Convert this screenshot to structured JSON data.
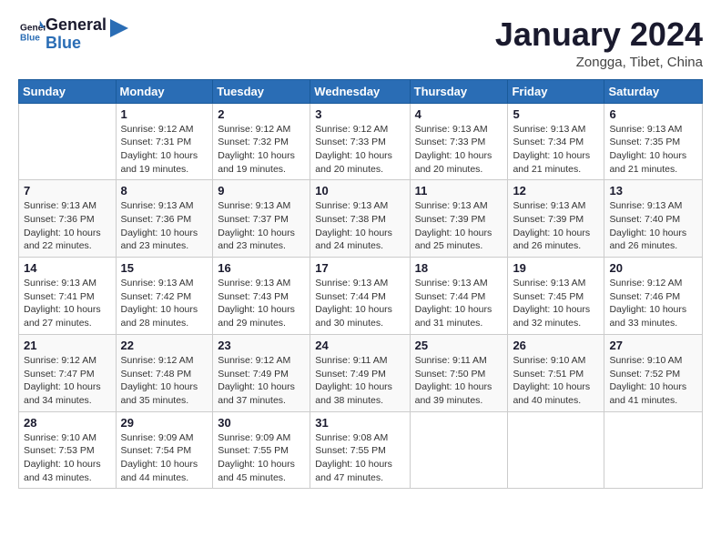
{
  "logo": {
    "line1": "General",
    "line2": "Blue"
  },
  "header": {
    "title": "January 2024",
    "subtitle": "Zongga, Tibet, China"
  },
  "weekdays": [
    "Sunday",
    "Monday",
    "Tuesday",
    "Wednesday",
    "Thursday",
    "Friday",
    "Saturday"
  ],
  "weeks": [
    [
      {
        "day": "",
        "info": ""
      },
      {
        "day": "1",
        "info": "Sunrise: 9:12 AM\nSunset: 7:31 PM\nDaylight: 10 hours\nand 19 minutes."
      },
      {
        "day": "2",
        "info": "Sunrise: 9:12 AM\nSunset: 7:32 PM\nDaylight: 10 hours\nand 19 minutes."
      },
      {
        "day": "3",
        "info": "Sunrise: 9:12 AM\nSunset: 7:33 PM\nDaylight: 10 hours\nand 20 minutes."
      },
      {
        "day": "4",
        "info": "Sunrise: 9:13 AM\nSunset: 7:33 PM\nDaylight: 10 hours\nand 20 minutes."
      },
      {
        "day": "5",
        "info": "Sunrise: 9:13 AM\nSunset: 7:34 PM\nDaylight: 10 hours\nand 21 minutes."
      },
      {
        "day": "6",
        "info": "Sunrise: 9:13 AM\nSunset: 7:35 PM\nDaylight: 10 hours\nand 21 minutes."
      }
    ],
    [
      {
        "day": "7",
        "info": "Sunrise: 9:13 AM\nSunset: 7:36 PM\nDaylight: 10 hours\nand 22 minutes."
      },
      {
        "day": "8",
        "info": "Sunrise: 9:13 AM\nSunset: 7:36 PM\nDaylight: 10 hours\nand 23 minutes."
      },
      {
        "day": "9",
        "info": "Sunrise: 9:13 AM\nSunset: 7:37 PM\nDaylight: 10 hours\nand 23 minutes."
      },
      {
        "day": "10",
        "info": "Sunrise: 9:13 AM\nSunset: 7:38 PM\nDaylight: 10 hours\nand 24 minutes."
      },
      {
        "day": "11",
        "info": "Sunrise: 9:13 AM\nSunset: 7:39 PM\nDaylight: 10 hours\nand 25 minutes."
      },
      {
        "day": "12",
        "info": "Sunrise: 9:13 AM\nSunset: 7:39 PM\nDaylight: 10 hours\nand 26 minutes."
      },
      {
        "day": "13",
        "info": "Sunrise: 9:13 AM\nSunset: 7:40 PM\nDaylight: 10 hours\nand 26 minutes."
      }
    ],
    [
      {
        "day": "14",
        "info": "Sunrise: 9:13 AM\nSunset: 7:41 PM\nDaylight: 10 hours\nand 27 minutes."
      },
      {
        "day": "15",
        "info": "Sunrise: 9:13 AM\nSunset: 7:42 PM\nDaylight: 10 hours\nand 28 minutes."
      },
      {
        "day": "16",
        "info": "Sunrise: 9:13 AM\nSunset: 7:43 PM\nDaylight: 10 hours\nand 29 minutes."
      },
      {
        "day": "17",
        "info": "Sunrise: 9:13 AM\nSunset: 7:44 PM\nDaylight: 10 hours\nand 30 minutes."
      },
      {
        "day": "18",
        "info": "Sunrise: 9:13 AM\nSunset: 7:44 PM\nDaylight: 10 hours\nand 31 minutes."
      },
      {
        "day": "19",
        "info": "Sunrise: 9:13 AM\nSunset: 7:45 PM\nDaylight: 10 hours\nand 32 minutes."
      },
      {
        "day": "20",
        "info": "Sunrise: 9:12 AM\nSunset: 7:46 PM\nDaylight: 10 hours\nand 33 minutes."
      }
    ],
    [
      {
        "day": "21",
        "info": "Sunrise: 9:12 AM\nSunset: 7:47 PM\nDaylight: 10 hours\nand 34 minutes."
      },
      {
        "day": "22",
        "info": "Sunrise: 9:12 AM\nSunset: 7:48 PM\nDaylight: 10 hours\nand 35 minutes."
      },
      {
        "day": "23",
        "info": "Sunrise: 9:12 AM\nSunset: 7:49 PM\nDaylight: 10 hours\nand 37 minutes."
      },
      {
        "day": "24",
        "info": "Sunrise: 9:11 AM\nSunset: 7:49 PM\nDaylight: 10 hours\nand 38 minutes."
      },
      {
        "day": "25",
        "info": "Sunrise: 9:11 AM\nSunset: 7:50 PM\nDaylight: 10 hours\nand 39 minutes."
      },
      {
        "day": "26",
        "info": "Sunrise: 9:10 AM\nSunset: 7:51 PM\nDaylight: 10 hours\nand 40 minutes."
      },
      {
        "day": "27",
        "info": "Sunrise: 9:10 AM\nSunset: 7:52 PM\nDaylight: 10 hours\nand 41 minutes."
      }
    ],
    [
      {
        "day": "28",
        "info": "Sunrise: 9:10 AM\nSunset: 7:53 PM\nDaylight: 10 hours\nand 43 minutes."
      },
      {
        "day": "29",
        "info": "Sunrise: 9:09 AM\nSunset: 7:54 PM\nDaylight: 10 hours\nand 44 minutes."
      },
      {
        "day": "30",
        "info": "Sunrise: 9:09 AM\nSunset: 7:55 PM\nDaylight: 10 hours\nand 45 minutes."
      },
      {
        "day": "31",
        "info": "Sunrise: 9:08 AM\nSunset: 7:55 PM\nDaylight: 10 hours\nand 47 minutes."
      },
      {
        "day": "",
        "info": ""
      },
      {
        "day": "",
        "info": ""
      },
      {
        "day": "",
        "info": ""
      }
    ]
  ]
}
